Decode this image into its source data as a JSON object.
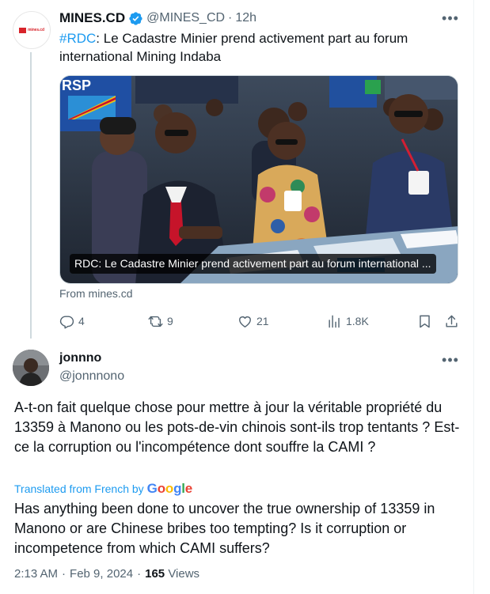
{
  "parent_tweet": {
    "avatar_text": "mines.cd",
    "display_name": "MINES.CD",
    "handle": "@MINES_CD",
    "separator": "·",
    "time": "12h",
    "hashtag": "#RDC",
    "text_rest": ": Le Cadastre Minier prend activement part au forum international Mining Indaba",
    "card_caption": "RDC: Le Cadastre Minier prend activement part au forum international ...",
    "card_banner_text": "RSP",
    "from_text": "From mines.cd",
    "actions": {
      "replies": "4",
      "retweets": "9",
      "likes": "21",
      "views": "1.8K"
    }
  },
  "reply_tweet": {
    "display_name": "jonnno",
    "handle": "@jonnnono",
    "original_text": "A-t-on fait quelque chose pour mettre à jour la véritable propriété du 13359 à Manono ou les pots-de-vin chinois sont-ils trop tentants ? Est-ce la corruption ou l'incompétence dont souffre la CAMI ?",
    "translated_from": "Translated from French by",
    "google": [
      "G",
      "o",
      "o",
      "g",
      "l",
      "e"
    ],
    "translation": "Has anything been done to uncover the true ownership of 13359 in Manono or are Chinese bribes too tempting? Is it corruption or incompetence from which CAMI suffers?",
    "time": "2:13 AM",
    "separator": "·",
    "date": "Feb 9, 2024",
    "separator2": "·",
    "views_count": "165",
    "views_label": "Views"
  },
  "colors": {
    "accent": "#1d9bf0",
    "text_secondary": "#536471",
    "text_primary": "#0f1419",
    "verified": "#1d9bf0",
    "brand_red": "#d8232a"
  },
  "icons": {
    "reply": "reply-icon",
    "retweet": "retweet-icon",
    "like": "heart-icon",
    "views": "views-icon",
    "bookmark": "bookmark-icon",
    "share": "share-icon",
    "more": "more-icon",
    "verified": "verified-badge-icon"
  }
}
